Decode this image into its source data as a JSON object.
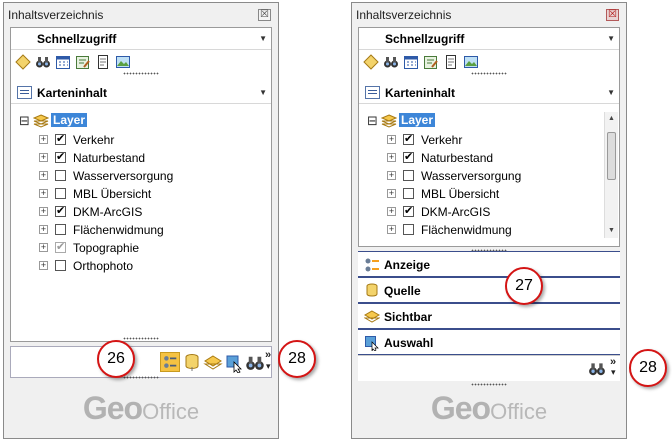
{
  "panel_left": {
    "title": "Inhaltsverzeichnis",
    "close_glyph": "☒",
    "quick_access": {
      "label": "Schnellzugriff",
      "dropdown_glyph": "▼",
      "icons": [
        "diamond-icon",
        "binoculars-icon",
        "calendar-grid-icon",
        "edit-form-icon",
        "page-icon",
        "map-image-icon"
      ]
    },
    "map_content": {
      "label": "Karteninhalt",
      "dropdown_glyph": "▼"
    },
    "tree": {
      "root": {
        "label": "Layer",
        "expander": "⊟"
      },
      "items": [
        {
          "label": "Verkehr",
          "check": "✔",
          "checked": true
        },
        {
          "label": "Naturbestand",
          "check": "✔",
          "checked": true
        },
        {
          "label": "Wasserversorgung",
          "check": "",
          "checked": false
        },
        {
          "label": "MBL Übersicht",
          "check": "",
          "checked": false
        },
        {
          "label": "DKM-ArcGIS",
          "check": "✔",
          "checked": true
        },
        {
          "label": "Flächenwidmung",
          "check": "",
          "checked": false
        },
        {
          "label": "Topographie",
          "check": "✔",
          "checked": true,
          "dimmed": true
        },
        {
          "label": "Orthophoto",
          "check": "",
          "checked": false
        }
      ],
      "expander_glyph": "+"
    },
    "footer_toolbar": {
      "icons": [
        "display-settings-icon",
        "source-icon",
        "visibility-icon",
        "selection-icon",
        "binoculars-icon"
      ],
      "more_glyph": "»",
      "more_arrow": "▾"
    },
    "callouts": [
      "26",
      "28"
    ],
    "logo": {
      "geo": "Geo",
      "office": "Office"
    }
  },
  "panel_right": {
    "title": "Inhaltsverzeichnis",
    "close_glyph": "☒",
    "quick_access": {
      "label": "Schnellzugriff",
      "dropdown_glyph": "▼"
    },
    "map_content": {
      "label": "Karteninhalt",
      "dropdown_glyph": "▼"
    },
    "tree": {
      "root": {
        "label": "Layer",
        "expander": "⊟"
      },
      "items": [
        {
          "label": "Verkehr",
          "check": "✔",
          "checked": true
        },
        {
          "label": "Naturbestand",
          "check": "✔",
          "checked": true
        },
        {
          "label": "Wasserversorgung",
          "check": "",
          "checked": false
        },
        {
          "label": "MBL Übersicht",
          "check": "",
          "checked": false
        },
        {
          "label": "DKM-ArcGIS",
          "check": "✔",
          "checked": true
        },
        {
          "label": "Flächenwidmung",
          "check": "",
          "checked": false
        }
      ]
    },
    "scroll": {
      "up": "▲",
      "down": "▼"
    },
    "nav_buttons": [
      {
        "label": "Anzeige",
        "icon": "display-settings-icon"
      },
      {
        "label": "Quelle",
        "icon": "source-icon"
      },
      {
        "label": "Sichtbar",
        "icon": "visibility-icon"
      },
      {
        "label": "Auswahl",
        "icon": "selection-icon"
      }
    ],
    "footer_toolbar": {
      "icons": [
        "binoculars-icon"
      ],
      "more_glyph": "»",
      "more_arrow": "▾"
    },
    "callouts": [
      "27",
      "28"
    ],
    "logo": {
      "geo": "Geo",
      "office": "Office"
    }
  },
  "colors": {
    "selection_blue": "#3d86d8",
    "nav_border": "#3b4e8c",
    "callout_red": "#d41414",
    "logo_gray": "#b2b2b2",
    "toolbar_highlight": "#f5c242"
  }
}
